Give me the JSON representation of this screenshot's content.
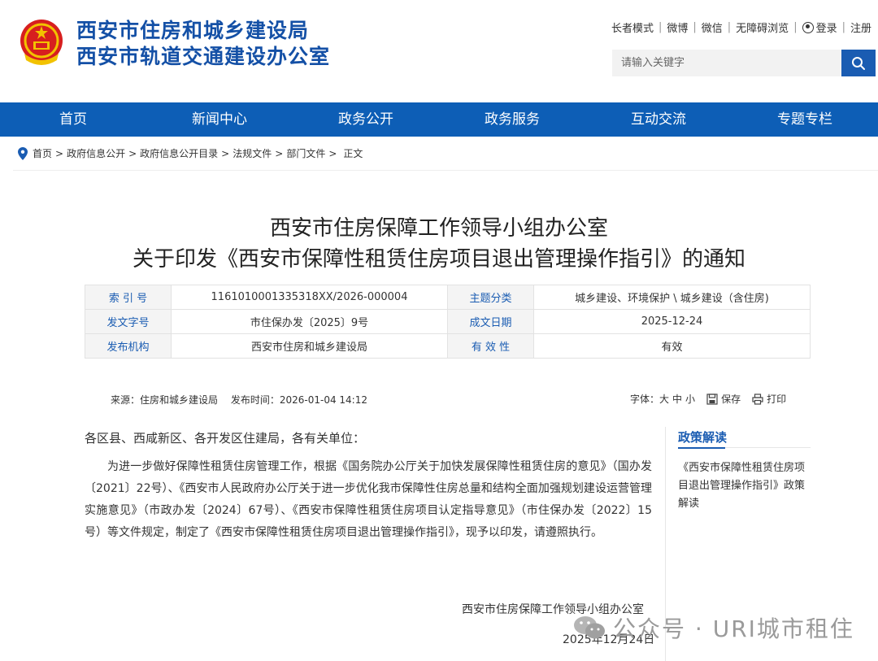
{
  "site": {
    "name_line1": "西安市住房和城乡建设局",
    "name_line2": "西安市轨道交通建设办公室",
    "emblem_icon": "national-emblem-icon"
  },
  "toplinks": {
    "elder_mode": "长者模式",
    "weibo": "微博",
    "wechat": "微信",
    "accessible": "无障碍浏览",
    "login": "登录",
    "register": "注册"
  },
  "search": {
    "placeholder": "请输入关键字",
    "icon": "search-icon"
  },
  "nav": {
    "items": [
      "首页",
      "新闻中心",
      "政务公开",
      "政务服务",
      "互动交流",
      "专题专栏"
    ]
  },
  "breadcrumb": {
    "items": [
      "首页",
      "政府信息公开",
      "政府信息公开目录",
      "法规文件",
      "部门文件",
      "正文"
    ],
    "separator": ">"
  },
  "article": {
    "title_line1": "西安市住房保障工作领导小组办公室",
    "title_line2": "关于印发《西安市保障性租赁住房项目退出管理操作指引》的通知",
    "meta": {
      "index_label": "索 引 号",
      "index_value": "1161010001335318XX/2026-000004",
      "topic_label": "主题分类",
      "topic_value": "城乡建设、环境保护 \\ 城乡建设（含住房)",
      "docno_label": "发文字号",
      "docno_value": "市住保办发〔2025〕9号",
      "date_label": "成文日期",
      "date_value": "2025-12-24",
      "issuer_label": "发布机构",
      "issuer_value": "西安市住房和城乡建设局",
      "valid_label": "有 效 性",
      "valid_value": "有效"
    },
    "source": "来源：住房和城乡建设局",
    "publish_time": "发布时间：2026-01-04 14:12",
    "font_label": "字体：",
    "font_large": "大",
    "font_medium": "中",
    "font_small": "小",
    "save": "保存",
    "print": "打印",
    "salutation": "各区县、西咸新区、各开发区住建局，各有关单位：",
    "body": "为进一步做好保障性租赁住房管理工作，根据《国务院办公厅关于加快发展保障性租赁住房的意见》（国办发〔2021〕22号）、《西安市人民政府办公厅关于进一步优化我市保障性住房总量和结构全面加强规划建设运营管理实施意见》（市政办发〔2024〕67号）、《西安市保障性租赁住房项目认定指导意见》（市住保办发〔2022〕15号）等文件规定，制定了《西安市保障性租赁住房项目退出管理操作指引》，现予以印发，请遵照执行。",
    "sign_org": "西安市住房保障工作领导小组办公室",
    "sign_date": "2025年12月24日"
  },
  "sidebar": {
    "title": "政策解读",
    "link": "《西安市保障性租赁住房项目退出管理操作指引》政策解读"
  },
  "watermark": {
    "text": "公众号 · URI城市租住",
    "icon": "wechat-icon"
  },
  "colors": {
    "brand_blue": "#1450a6",
    "nav_blue": "#0d5eb6"
  }
}
